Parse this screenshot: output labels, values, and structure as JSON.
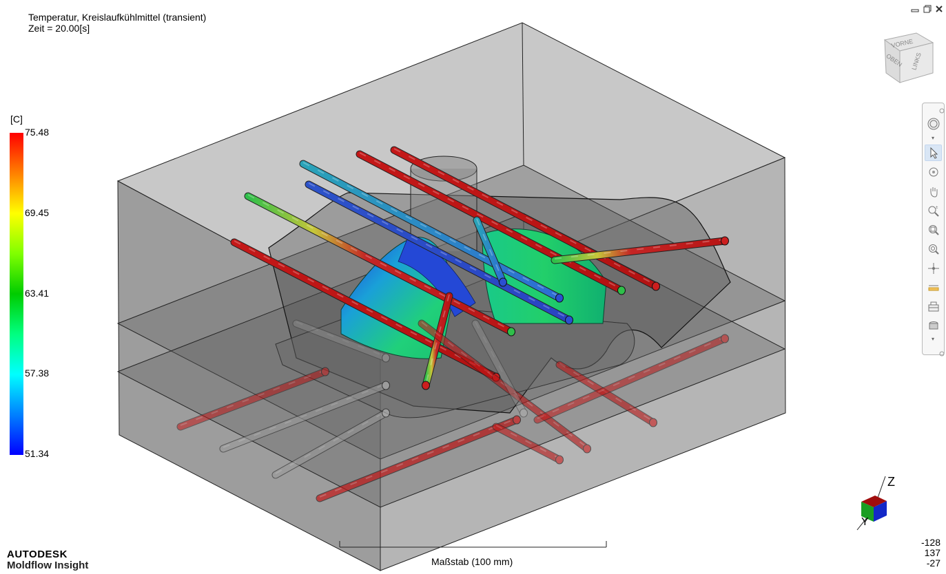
{
  "header": {
    "line1": "Temperatur, Kreislaufkühlmittel (transient)",
    "line2": "Zeit = 20.00[s]"
  },
  "legend": {
    "unit": "[C]",
    "ticks": [
      "75.48",
      "69.45",
      "63.41",
      "57.38",
      "51.34"
    ],
    "gradient_colors": [
      "#ff0000",
      "#ff8000",
      "#ffff00",
      "#80ff00",
      "#00cc00",
      "#00ff80",
      "#00ffff",
      "#0080ff",
      "#0000ff"
    ]
  },
  "window_controls": {
    "minimize": "minimize-icon",
    "restore": "restore-icon",
    "close": "close-icon"
  },
  "view_cube": {
    "faces": [
      "OBEN",
      "LINKS",
      "VORNE"
    ]
  },
  "toolbar": {
    "items": [
      "steering-wheel-icon",
      "select-pointer-icon",
      "rotate-icon",
      "pan-hand-icon",
      "zoom-icon",
      "zoom-window-icon",
      "zoom-fit-icon",
      "center-icon",
      "measure-icon",
      "section-plane-icon",
      "model-display-icon"
    ]
  },
  "axis_triad": {
    "z_label": "Z",
    "y_label": "Y"
  },
  "scale": {
    "label": "Maßstab (100 mm)"
  },
  "coords": [
    "-128",
    "137",
    "-27"
  ],
  "branding": {
    "company": "AUTODESK",
    "product": "Moldflow Insight"
  },
  "colors": {
    "hot": "#cc1f1f",
    "warm": "#d6c53a",
    "mid": "#2fbf4a",
    "cool": "#2bb3c2",
    "cold": "#2b4fd1",
    "mold_gray": "#7d7d7d"
  }
}
